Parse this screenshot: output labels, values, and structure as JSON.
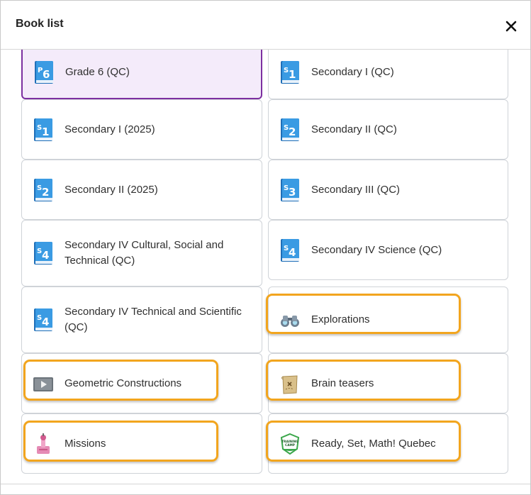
{
  "dialog": {
    "title": "Book list",
    "close_symbol": "✕"
  },
  "books": [
    {
      "label": "Grade 6 (QC)",
      "icon": "book-p6-icon",
      "badge_small": "P",
      "badge_big": "6",
      "selected": true
    },
    {
      "label": "Secondary I (QC)",
      "icon": "book-s1-icon",
      "badge_small": "S",
      "badge_big": "1"
    },
    {
      "label": "Secondary I (2025)",
      "icon": "book-s1-icon",
      "badge_small": "S",
      "badge_big": "1"
    },
    {
      "label": "Secondary II (QC)",
      "icon": "book-s2-icon",
      "badge_small": "S",
      "badge_big": "2"
    },
    {
      "label": "Secondary II (2025)",
      "icon": "book-s2-icon",
      "badge_small": "S",
      "badge_big": "2"
    },
    {
      "label": "Secondary III (QC)",
      "icon": "book-s3-icon",
      "badge_small": "S",
      "badge_big": "3"
    },
    {
      "label": "Secondary IV Cultural, Social and Technical (QC)",
      "icon": "book-s4-icon",
      "badge_small": "S",
      "badge_big": "4"
    },
    {
      "label": "Secondary IV Science (QC)",
      "icon": "book-s4-icon",
      "badge_small": "S",
      "badge_big": "4"
    },
    {
      "label": "Secondary IV Technical and Scientific (QC)",
      "icon": "book-s4-icon",
      "badge_small": "S",
      "badge_big": "4"
    },
    {
      "label": "Explorations",
      "icon": "binoculars-icon",
      "highlighted": true
    },
    {
      "label": "Geometric Constructions",
      "icon": "video-play-icon",
      "highlighted": true
    },
    {
      "label": "Brain teasers",
      "icon": "treasure-map-icon",
      "highlighted": true
    },
    {
      "label": "Missions",
      "icon": "rocket-tower-icon",
      "highlighted": true
    },
    {
      "label": "Ready, Set, Math! Quebec",
      "icon": "training-camp-badge-icon",
      "badge_text_1": "TRAINING",
      "badge_text_2": "CAMP",
      "highlighted": true
    }
  ],
  "colors": {
    "book_blue": "#2a86d6",
    "selected_bg": "#f4ebfa",
    "selected_border": "#7c2fa0",
    "highlight": "#f2a51e"
  }
}
